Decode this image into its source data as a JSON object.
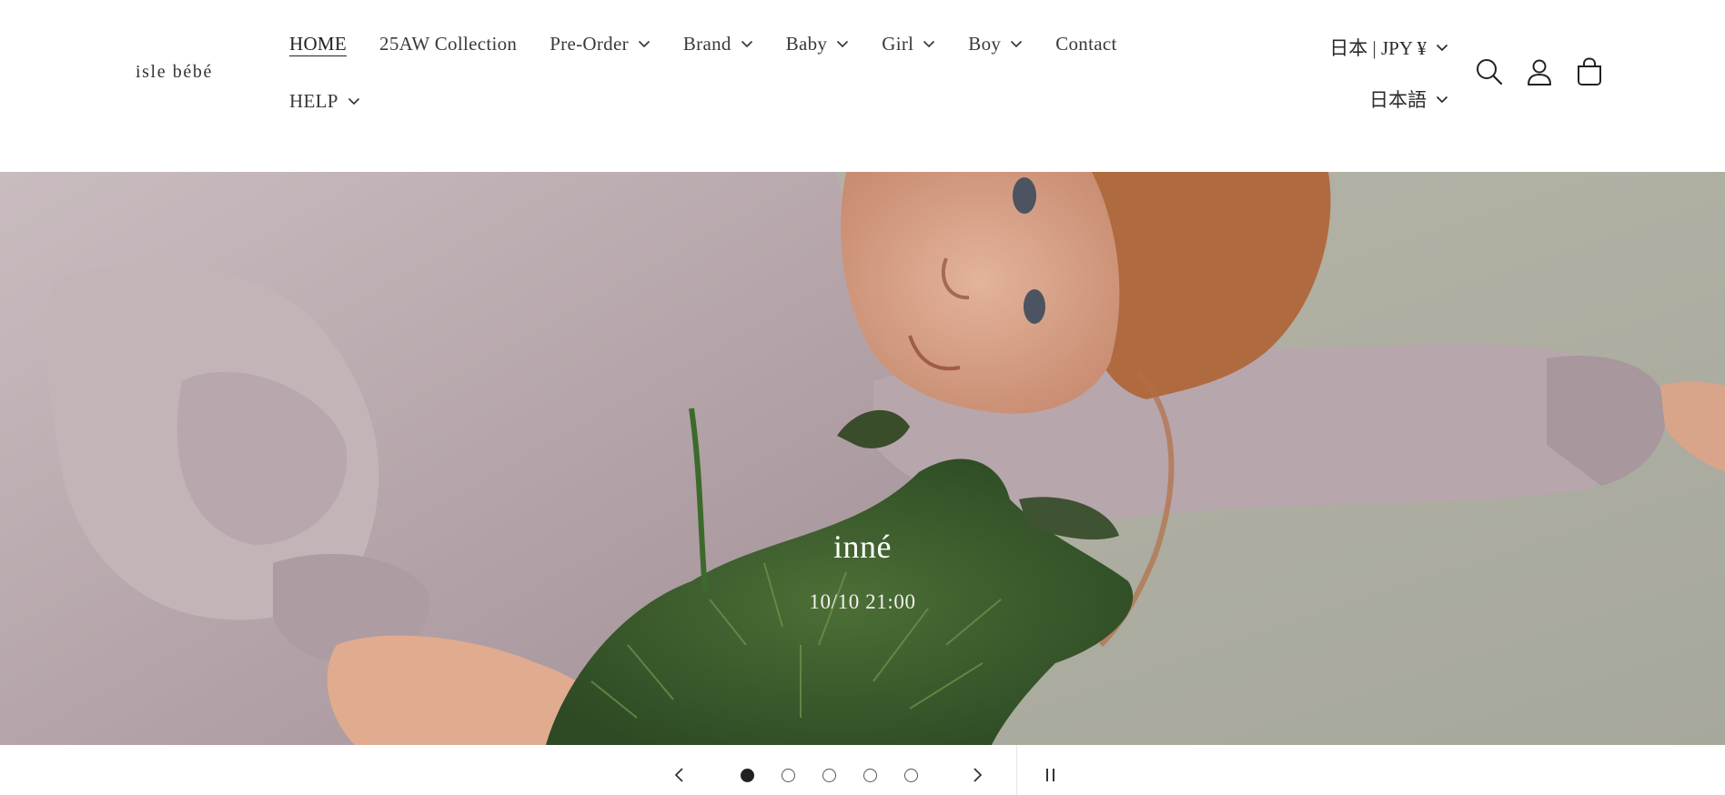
{
  "header": {
    "logo": "isle bébé",
    "nav": [
      {
        "label": "HOME",
        "active": true,
        "dropdown": false
      },
      {
        "label": "25AW Collection",
        "active": false,
        "dropdown": false
      },
      {
        "label": "Pre-Order",
        "active": false,
        "dropdown": true
      },
      {
        "label": "Brand",
        "active": false,
        "dropdown": true
      },
      {
        "label": "Baby",
        "active": false,
        "dropdown": true
      },
      {
        "label": "Girl",
        "active": false,
        "dropdown": true
      },
      {
        "label": "Boy",
        "active": false,
        "dropdown": true
      },
      {
        "label": "Contact",
        "active": false,
        "dropdown": false
      },
      {
        "label": "HELP",
        "active": false,
        "dropdown": true
      }
    ],
    "country_selector": "日本 | JPY ¥",
    "language_selector": "日本語",
    "icons": [
      "search-icon",
      "account-icon",
      "cart-icon"
    ]
  },
  "hero": {
    "title": "inné",
    "subtitle": "10/10 21:00"
  },
  "slider": {
    "slide_count": 5,
    "active_index": 0,
    "icons": [
      "chevron-left-icon",
      "chevron-right-icon",
      "pause-icon"
    ]
  },
  "colors": {
    "text": "#2a2a2a",
    "background": "#ffffff",
    "dot_active": "#222222"
  }
}
